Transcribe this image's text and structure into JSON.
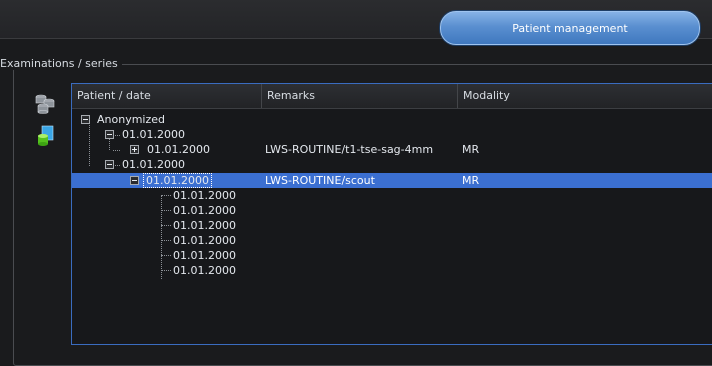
{
  "header": {
    "patient_management_label": "Patient management"
  },
  "group": {
    "title": "Examinations / series"
  },
  "side_icons": [
    "database-stack-icon",
    "export-db-icon"
  ],
  "table": {
    "columns": [
      "Patient / date",
      "Remarks",
      "Modality"
    ],
    "rows": [
      {
        "label": "Anonymized",
        "remarks": "",
        "modality": ""
      },
      {
        "label": "01.01.2000",
        "remarks": "",
        "modality": ""
      },
      {
        "label": "01.01.2000",
        "remarks": "LWS-ROUTINE/t1-tse-sag-4mm",
        "modality": "MR"
      },
      {
        "label": "01.01.2000",
        "remarks": "",
        "modality": ""
      },
      {
        "label": "01.01.2000",
        "remarks": "LWS-ROUTINE/scout",
        "modality": "MR",
        "selected": true
      },
      {
        "label": "01.01.2000",
        "remarks": "",
        "modality": ""
      },
      {
        "label": "01.01.2000",
        "remarks": "",
        "modality": ""
      },
      {
        "label": "01.01.2000",
        "remarks": "",
        "modality": ""
      },
      {
        "label": "01.01.2000",
        "remarks": "",
        "modality": ""
      },
      {
        "label": "01.01.2000",
        "remarks": "",
        "modality": ""
      },
      {
        "label": "01.01.2000",
        "remarks": "",
        "modality": ""
      }
    ]
  },
  "colors": {
    "accent": "#3b6fd1",
    "button": "#5a8fd0",
    "background": "#1a1b1d"
  }
}
